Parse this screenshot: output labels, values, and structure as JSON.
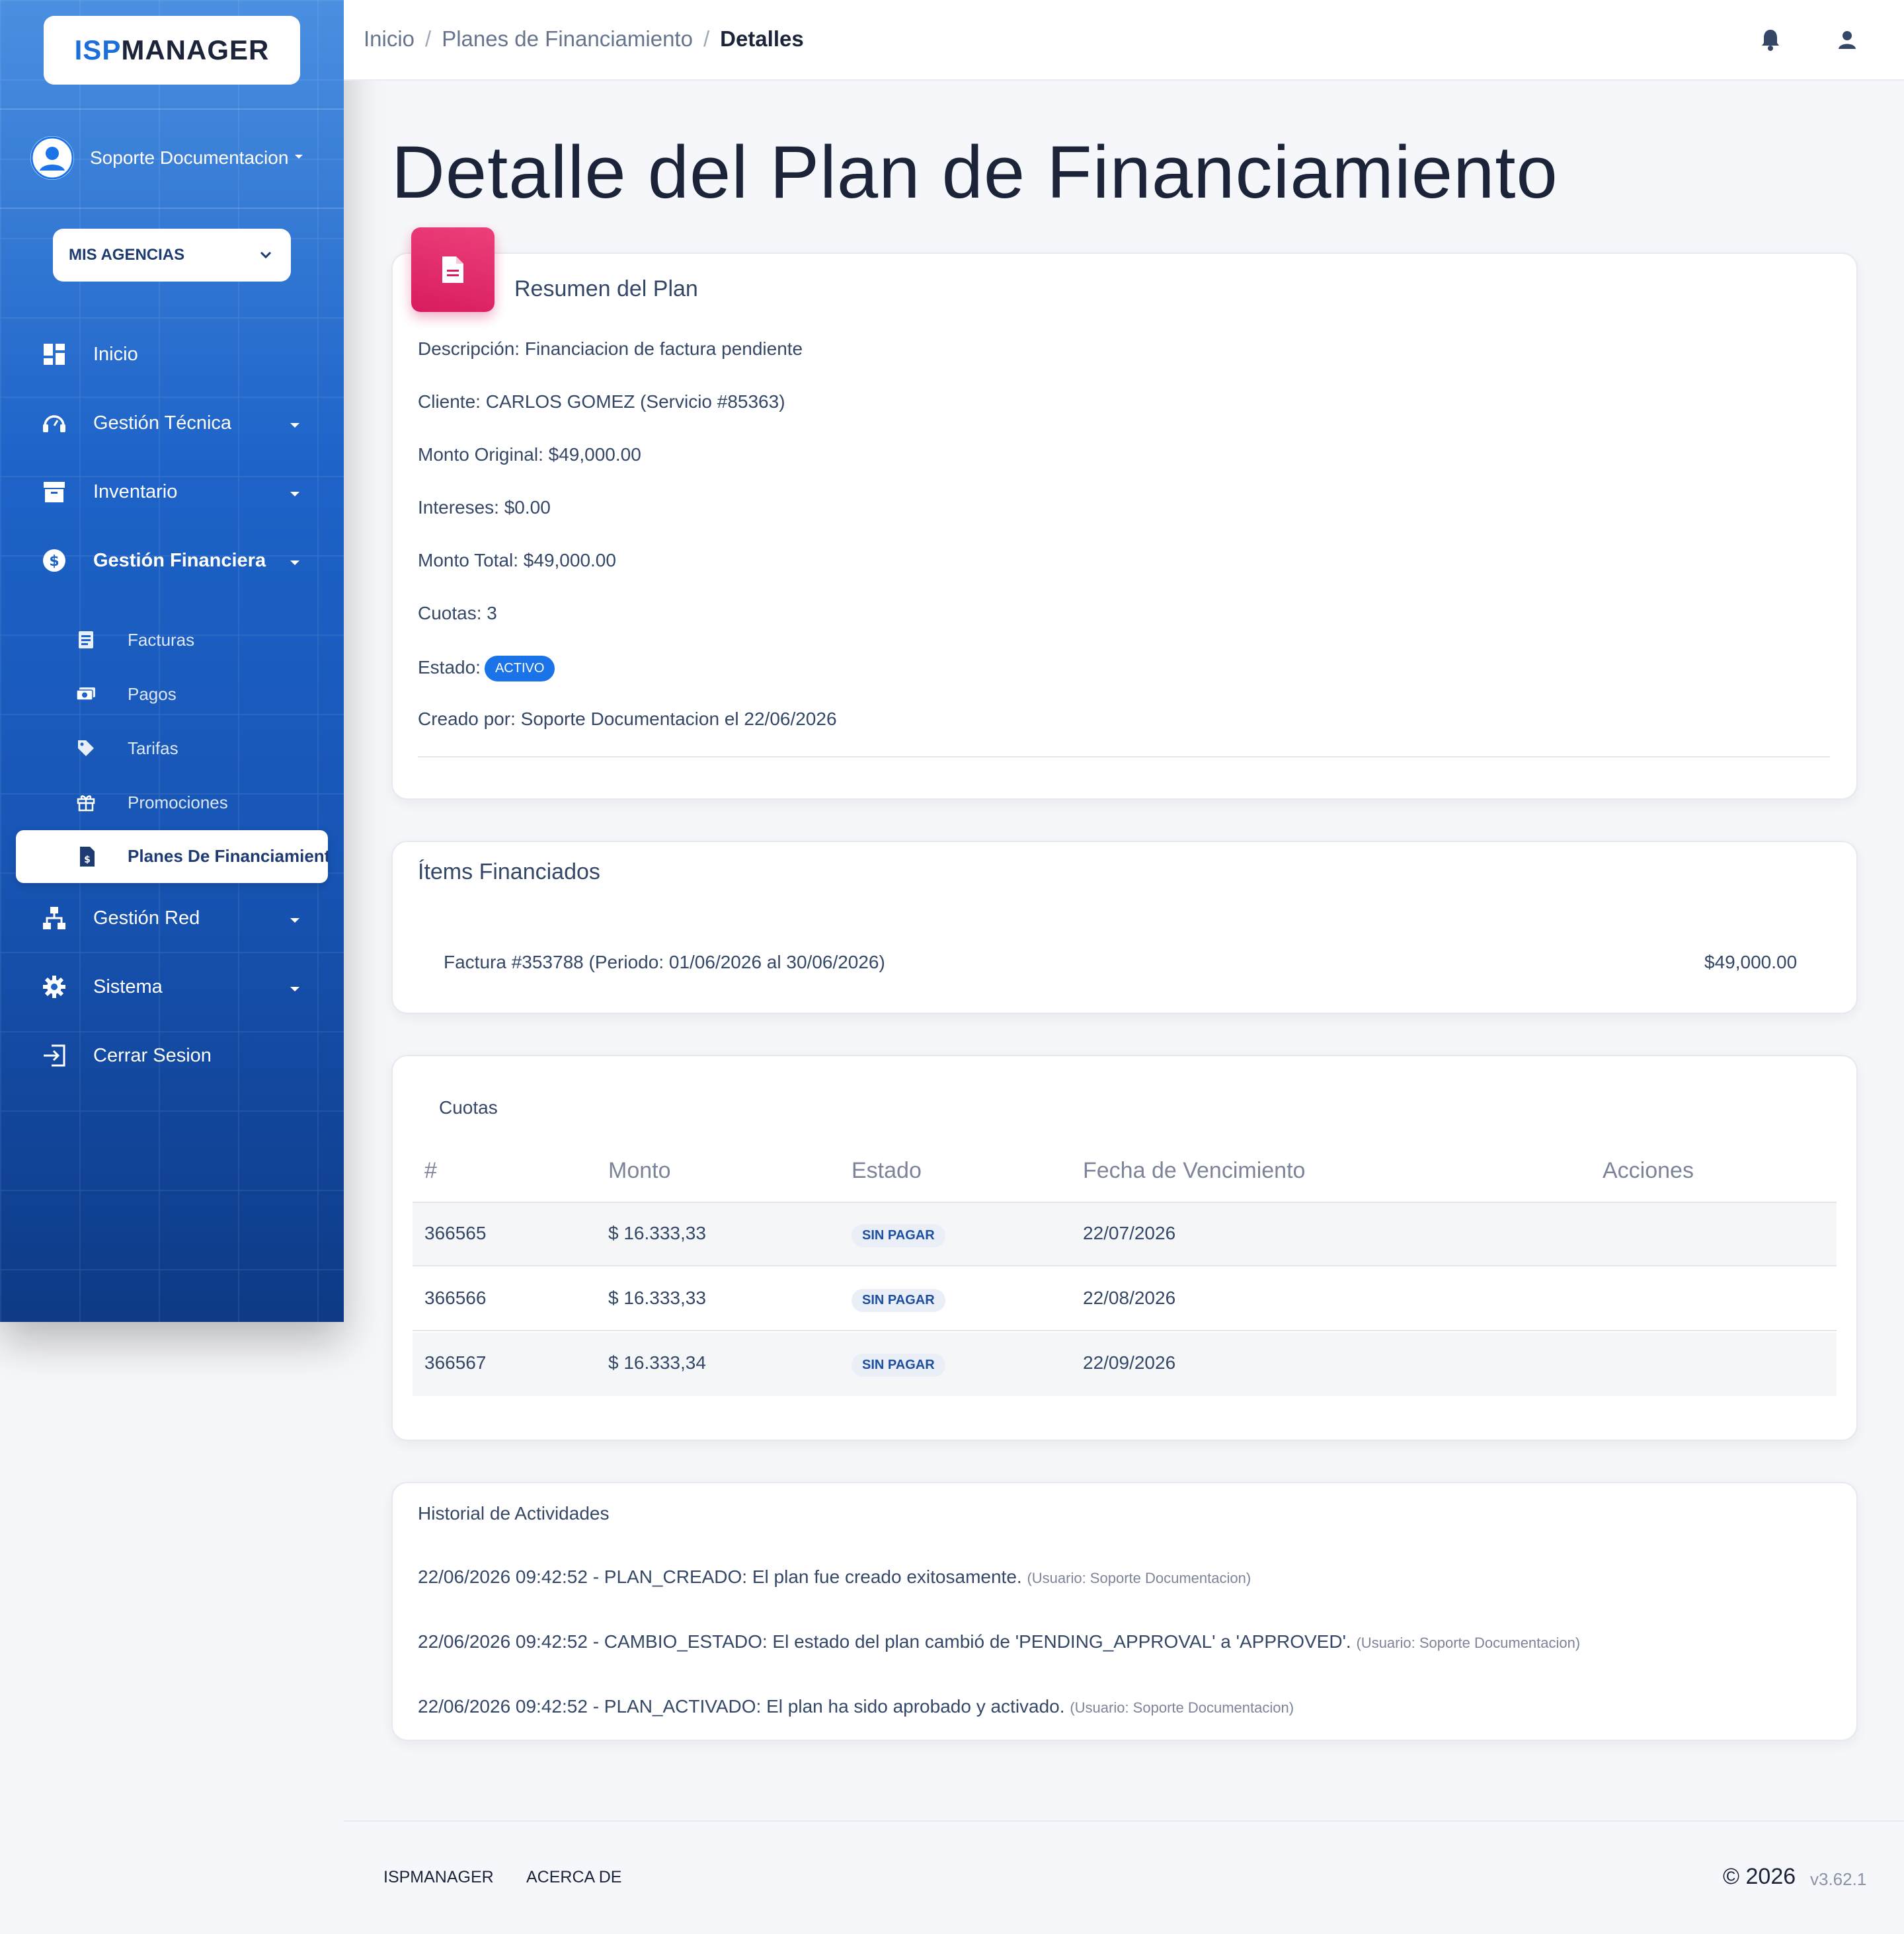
{
  "brand": {
    "logo_part1": "ISP",
    "logo_part2": "MANAGER",
    "primary_color": "#1a73e8",
    "accent_color": "#d81b60"
  },
  "user": {
    "name": "Soporte Documentacion"
  },
  "agency_selector": {
    "label": "MIS AGENCIAS"
  },
  "nav": {
    "inicio": "Inicio",
    "gestion_tecnica": "Gestión Técnica",
    "inventario": "Inventario",
    "gestion_financiera": "Gestión Financiera",
    "sub": {
      "facturas": "Facturas",
      "pagos": "Pagos",
      "tarifas": "Tarifas",
      "promociones": "Promociones",
      "planes": "Planes De Financiamiento"
    },
    "gestion_red": "Gestión Red",
    "sistema": "Sistema",
    "cerrar": "Cerrar Sesion"
  },
  "breadcrumb": {
    "home": "Inicio",
    "section": "Planes de Financiamiento",
    "current": "Detalles",
    "separator": "/"
  },
  "page": {
    "title": "Detalle del Plan de Financiamiento"
  },
  "summary": {
    "title": "Resumen del Plan",
    "descripcion": "Descripción: Financiacion de factura pendiente",
    "cliente": "Cliente: CARLOS GOMEZ (Servicio #85363)",
    "monto_original": "Monto Original: $49,000.00",
    "intereses": "Intereses: $0.00",
    "monto_total": "Monto Total: $49,000.00",
    "cuotas": "Cuotas: 3",
    "estado_label": "Estado:",
    "estado_badge": "ACTIVO",
    "creado_por": "Creado por: Soporte Documentacion el 22/06/2026"
  },
  "items": {
    "title": "Ítems Financiados",
    "rows": [
      {
        "desc": "Factura #353788 (Periodo: 01/06/2026 al 30/06/2026)",
        "amount": "$49,000.00"
      }
    ]
  },
  "cuotas": {
    "title": "Cuotas",
    "headers": [
      "#",
      "Monto",
      "Estado",
      "Fecha de Vencimiento",
      "Acciones"
    ],
    "rows": [
      {
        "id": "366565",
        "monto": "$ 16.333,33",
        "estado": "SIN PAGAR",
        "fecha": "22/07/2026"
      },
      {
        "id": "366566",
        "monto": "$ 16.333,33",
        "estado": "SIN PAGAR",
        "fecha": "22/08/2026"
      },
      {
        "id": "366567",
        "monto": "$ 16.333,34",
        "estado": "SIN PAGAR",
        "fecha": "22/09/2026"
      }
    ]
  },
  "historial": {
    "title": "Historial de Actividades",
    "entries": [
      {
        "text": "22/06/2026 09:42:52 - PLAN_CREADO: El plan fue creado exitosamente.",
        "user": "(Usuario: Soporte Documentacion)"
      },
      {
        "text": "22/06/2026 09:42:52 - CAMBIO_ESTADO: El estado del plan cambió de 'PENDING_APPROVAL' a 'APPROVED'.",
        "user": "(Usuario: Soporte Documentacion)"
      },
      {
        "text": "22/06/2026 09:42:52 - PLAN_ACTIVADO: El plan ha sido aprobado y activado.",
        "user": "(Usuario: Soporte Documentacion)"
      }
    ]
  },
  "footer": {
    "link1": "ISPMANAGER",
    "link2": "ACERCA DE",
    "copyright": "© 2026",
    "version": "v3.62.1"
  }
}
